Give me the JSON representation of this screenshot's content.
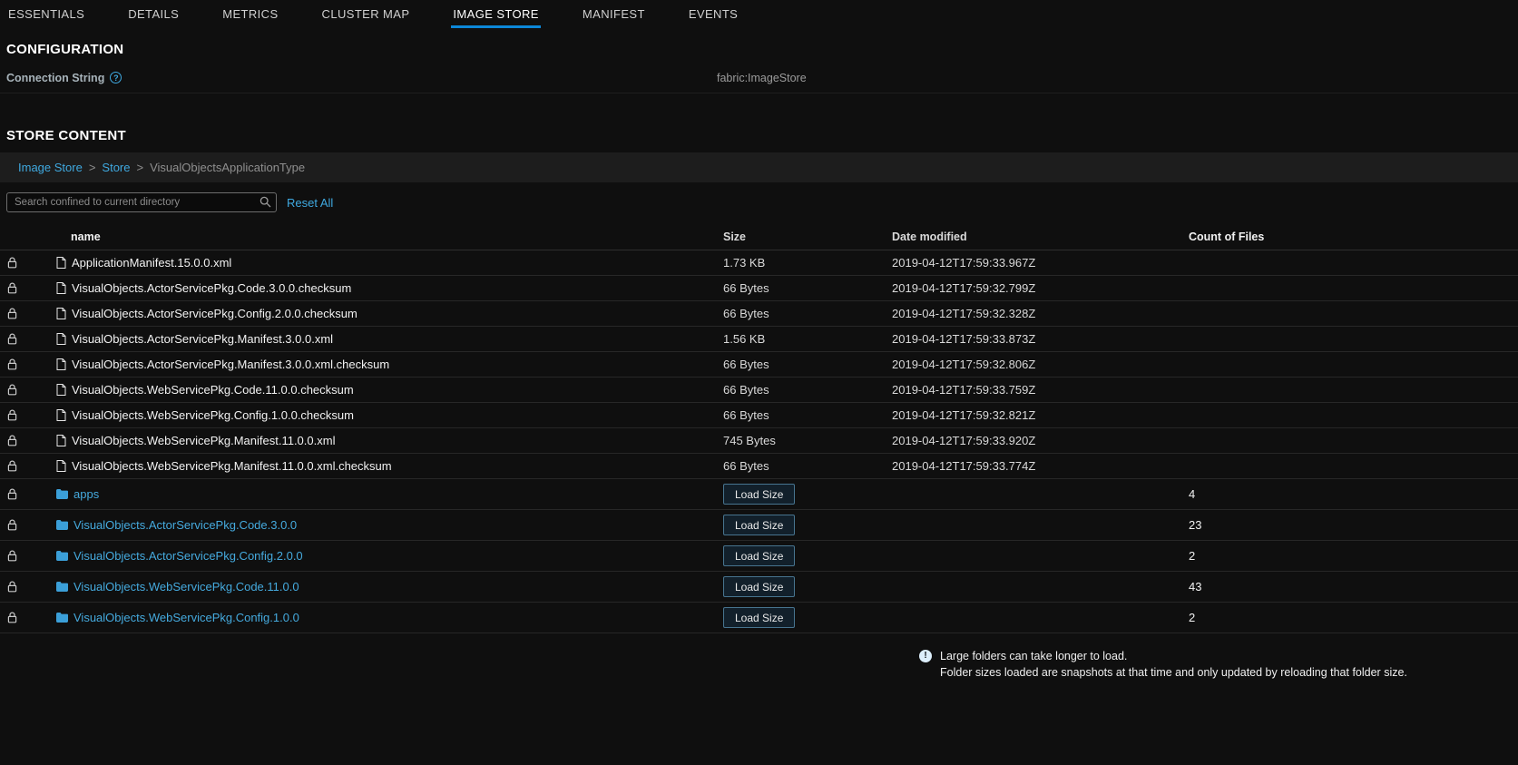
{
  "tabs": [
    {
      "label": "ESSENTIALS",
      "active": false
    },
    {
      "label": "DETAILS",
      "active": false
    },
    {
      "label": "METRICS",
      "active": false
    },
    {
      "label": "CLUSTER MAP",
      "active": false
    },
    {
      "label": "IMAGE STORE",
      "active": true
    },
    {
      "label": "MANIFEST",
      "active": false
    },
    {
      "label": "EVENTS",
      "active": false
    }
  ],
  "configuration": {
    "title": "CONFIGURATION",
    "connection_string_label": "Connection String",
    "connection_string_value": "fabric:ImageStore"
  },
  "store_content": {
    "title": "STORE CONTENT",
    "breadcrumbs": [
      {
        "label": "Image Store",
        "link": true
      },
      {
        "label": "Store",
        "link": true
      },
      {
        "label": "VisualObjectsApplicationType",
        "link": false
      }
    ],
    "search_placeholder": "Search confined to current directory",
    "reset_all_label": "Reset All",
    "columns": [
      "name",
      "Size",
      "Date modified",
      "Count of Files"
    ],
    "load_size_label": "Load Size",
    "files": [
      {
        "name": "ApplicationManifest.15.0.0.xml",
        "size": "1.73 KB",
        "modified": "2019-04-12T17:59:33.967Z"
      },
      {
        "name": "VisualObjects.ActorServicePkg.Code.3.0.0.checksum",
        "size": "66 Bytes",
        "modified": "2019-04-12T17:59:32.799Z"
      },
      {
        "name": "VisualObjects.ActorServicePkg.Config.2.0.0.checksum",
        "size": "66 Bytes",
        "modified": "2019-04-12T17:59:32.328Z"
      },
      {
        "name": "VisualObjects.ActorServicePkg.Manifest.3.0.0.xml",
        "size": "1.56 KB",
        "modified": "2019-04-12T17:59:33.873Z"
      },
      {
        "name": "VisualObjects.ActorServicePkg.Manifest.3.0.0.xml.checksum",
        "size": "66 Bytes",
        "modified": "2019-04-12T17:59:32.806Z"
      },
      {
        "name": "VisualObjects.WebServicePkg.Code.11.0.0.checksum",
        "size": "66 Bytes",
        "modified": "2019-04-12T17:59:33.759Z"
      },
      {
        "name": "VisualObjects.WebServicePkg.Config.1.0.0.checksum",
        "size": "66 Bytes",
        "modified": "2019-04-12T17:59:32.821Z"
      },
      {
        "name": "VisualObjects.WebServicePkg.Manifest.11.0.0.xml",
        "size": "745 Bytes",
        "modified": "2019-04-12T17:59:33.920Z"
      },
      {
        "name": "VisualObjects.WebServicePkg.Manifest.11.0.0.xml.checksum",
        "size": "66 Bytes",
        "modified": "2019-04-12T17:59:33.774Z"
      }
    ],
    "folders": [
      {
        "name": "apps",
        "count": "4"
      },
      {
        "name": "VisualObjects.ActorServicePkg.Code.3.0.0",
        "count": "23"
      },
      {
        "name": "VisualObjects.ActorServicePkg.Config.2.0.0",
        "count": "2"
      },
      {
        "name": "VisualObjects.WebServicePkg.Code.11.0.0",
        "count": "43"
      },
      {
        "name": "VisualObjects.WebServicePkg.Config.1.0.0",
        "count": "2"
      }
    ]
  },
  "footer": {
    "line1": "Large folders can take longer to load.",
    "line2": "Folder sizes loaded are snapshots at that time and only updated by reloading that folder size."
  },
  "colors": {
    "accent": "#0c87d8",
    "link": "#3fa9e0",
    "folder_icon": "#3b9fd8",
    "background": "#0f0f0f",
    "breadcrumb_background": "#1d1d1d"
  }
}
